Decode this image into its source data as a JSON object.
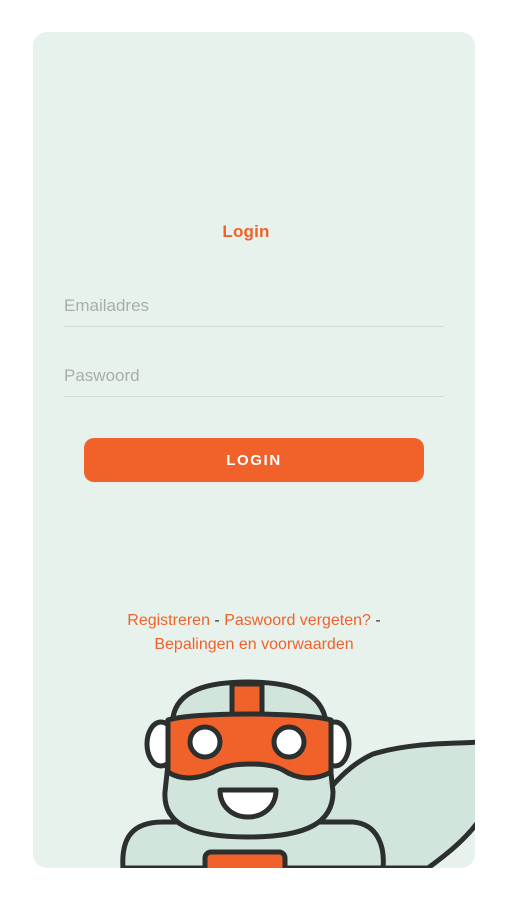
{
  "login": {
    "title": "Login",
    "email_placeholder": "Emailadres",
    "password_placeholder": "Paswoord",
    "button_label": "LOGIN"
  },
  "links": {
    "register": "Registreren",
    "separator_1": " - ",
    "forgot_password": "Paswoord vergeten?",
    "separator_2": " -",
    "terms": "Bepalingen en voorwaarden"
  },
  "colors": {
    "accent": "#f0622a",
    "background": "#e8f2ed",
    "mascot_body": "#d2e5dc",
    "outline": "#2b2f2e"
  },
  "illustration": {
    "name": "robot-mascot"
  }
}
